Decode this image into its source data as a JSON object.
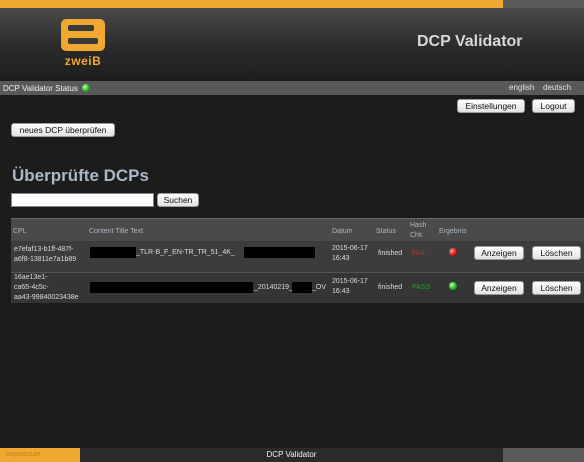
{
  "logo": {
    "text": "zweiB"
  },
  "header": {
    "title": "DCP Validator"
  },
  "statusbar": {
    "label": "DCP Validator Status",
    "status_color": "#22aa22",
    "lang_en": "english",
    "lang_de": "deutsch"
  },
  "toolbar": {
    "settings_label": "Einstellungen",
    "logout_label": "Logout",
    "check_dcp_label": "neues DCP überprüfen"
  },
  "main": {
    "heading": "Überprüfte DCPs",
    "search": {
      "value": "",
      "button_label": "Suchen"
    }
  },
  "table": {
    "columns": {
      "cpl": "CPL",
      "title": "Content Title Text",
      "date": "Datum",
      "status": "Status",
      "hash1": "Hash",
      "hash2": "Chk",
      "result": "Ergebnis"
    },
    "rows": [
      {
        "cpl": [
          "e7efaf13-b1ff-487f-",
          "a6f8-13811e7a1b89"
        ],
        "title": "_TLR-B_F_EN-TR_TR_51_4K_",
        "date": [
          "2015-06-17",
          "16:43"
        ],
        "status": "finished",
        "hash": "FAIL",
        "hash_color": "#e02020",
        "result": "fail",
        "view_label": "Anzeigen",
        "delete_label": "Löschen"
      },
      {
        "cpl": [
          "16ae13e1-",
          "ca65-4c5c-",
          "aa43-99840023438e"
        ],
        "title_a": "_20140219_",
        "title_b": "_OV",
        "date": [
          "2015-06-17",
          "16:43"
        ],
        "status": "finished",
        "hash": "PASS",
        "hash_color": "#22a022",
        "result": "pass",
        "view_label": "Anzeigen",
        "delete_label": "Löschen"
      }
    ]
  },
  "footer": {
    "title": "DCP Validator",
    "left_text": "Impressum"
  }
}
